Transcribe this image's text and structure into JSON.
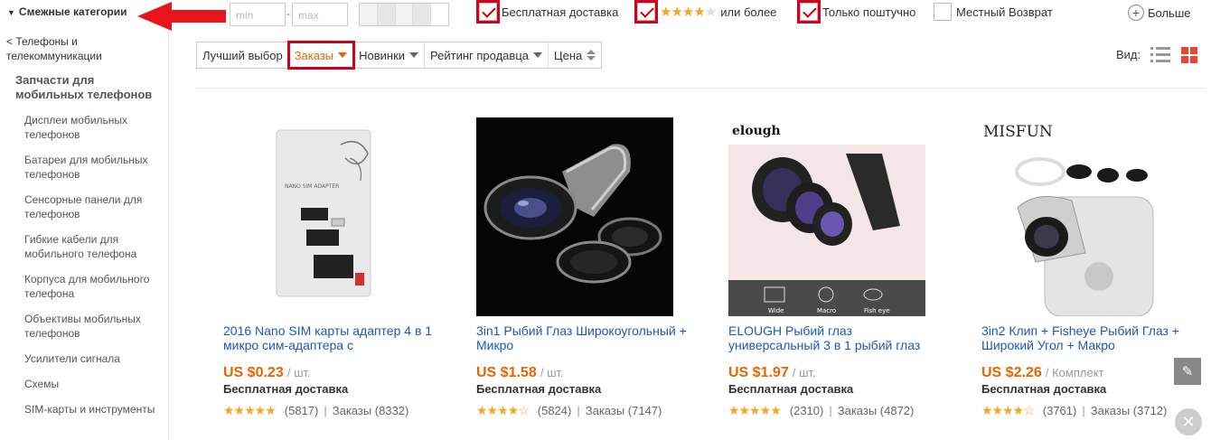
{
  "sidebar": {
    "heading": "Смежные категории",
    "back_link": "< Телефоны и телекоммуникации",
    "parent": "Запчасти для мобильных телефонов",
    "items": [
      {
        "label": "Дисплеи мобильных телефонов"
      },
      {
        "label": "Батареи для мобильных телефонов"
      },
      {
        "label": "Сенсорные панели для телефонов"
      },
      {
        "label": "Гибкие кабели для мобильного телефона"
      },
      {
        "label": "Корпуса для мобильного телефона"
      },
      {
        "label": "Объективы мобильных телефонов"
      },
      {
        "label": "Усилители сигнала"
      },
      {
        "label": "Схемы"
      },
      {
        "label": "SIM-карты и инструменты"
      }
    ]
  },
  "filters": {
    "price_min_placeholder": "min",
    "price_max_placeholder": "max",
    "price_dash": "-",
    "free_shipping": {
      "label": "Бесплатная доставка",
      "checked": true
    },
    "rating": {
      "label": "или более",
      "checked": true,
      "stars": 4
    },
    "single_item": {
      "label": "Только поштучно",
      "checked": true
    },
    "local_return": {
      "label": "Местный Возврат",
      "checked": false
    },
    "more": "Больше"
  },
  "sort": {
    "options": [
      {
        "label": "Лучший выбор",
        "active": false,
        "indicator": "none"
      },
      {
        "label": "Заказы",
        "active": true,
        "indicator": "caret"
      },
      {
        "label": "Новинки",
        "active": false,
        "indicator": "caret"
      },
      {
        "label": "Рейтинг продавца",
        "active": false,
        "indicator": "caret"
      },
      {
        "label": "Цена",
        "active": false,
        "indicator": "updown"
      }
    ],
    "view_label": "Вид:"
  },
  "products": [
    {
      "title": "2016 Nano SIM карты адаптер 4 в 1 микро сим-адаптера с",
      "price": "US $0.23",
      "unit": "/ шт.",
      "shipping": "Бесплатная доставка",
      "rating": 5,
      "reviews": "(5817)",
      "orders": "Заказы (8332)",
      "image_text": "NANO SIM ADAPTER",
      "brand": ""
    },
    {
      "title": "3in1 Рыбий Глаз Широкоугольный + Микро",
      "price": "US $1.58",
      "unit": "/ шт.",
      "shipping": "Бесплатная доставка",
      "rating": 4.5,
      "reviews": "(5824)",
      "orders": "Заказы (7147)",
      "image_text": "",
      "brand": ""
    },
    {
      "title": "ELOUGH Рыбий глаз универсальный 3 в 1 рыбий глаз",
      "price": "US $1.97",
      "unit": "/ шт.",
      "shipping": "Бесплатная доставка",
      "rating": 5,
      "reviews": "(2310)",
      "orders": "Заказы (4872)",
      "image_text": "",
      "brand": "elough",
      "image_labels": [
        "Wide",
        "Macro",
        "Fish eye"
      ]
    },
    {
      "title": "3in2 Клип + Fisheye Рыбий Глаз + Широкий Угол + Макро",
      "price": "US $2.26",
      "unit": "/ Комплект",
      "shipping": "Бесплатная доставка",
      "rating": 4.5,
      "reviews": "(3761)",
      "orders": "Заказы (3712)",
      "image_text": "",
      "brand": "MISFUN"
    }
  ],
  "colors": {
    "accent": "#e56600",
    "link": "#1a5ab6",
    "highlight": "#d0021b",
    "star": "#f5a623"
  },
  "icons": [
    "check-icon",
    "star-icon",
    "plus-circle-icon",
    "list-view-icon",
    "grid-view-icon",
    "edit-icon",
    "close-icon",
    "arrow-icon"
  ]
}
